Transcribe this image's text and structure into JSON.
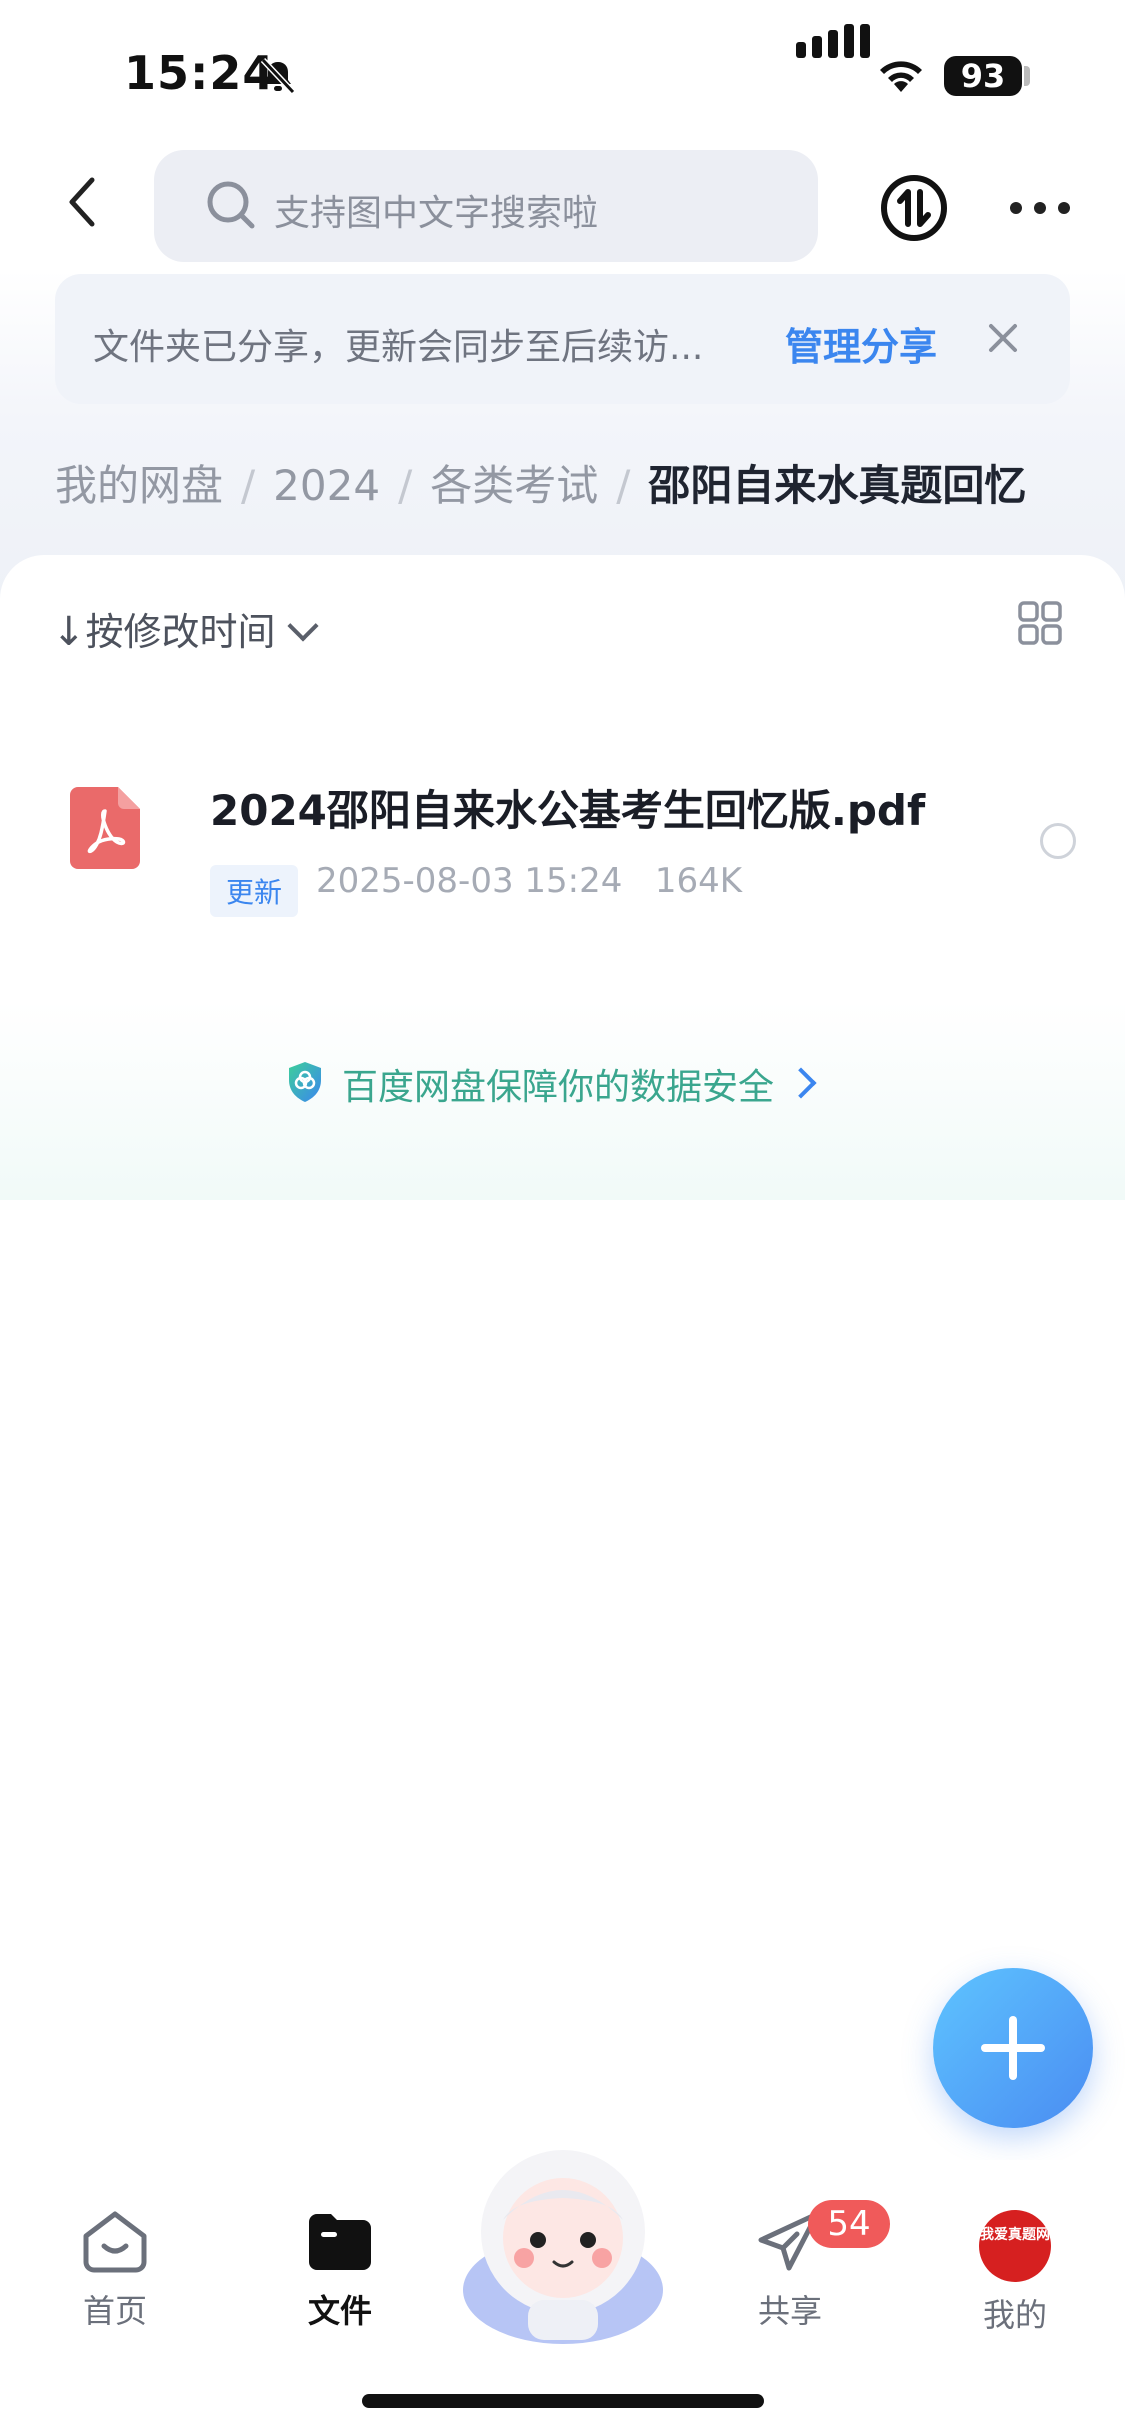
{
  "status_bar": {
    "time": "15:24",
    "battery": "93"
  },
  "search": {
    "placeholder": "支持图中文字搜索啦"
  },
  "notice": {
    "text": "文件夹已分享，更新会同步至后续访...",
    "link": "管理分享"
  },
  "breadcrumb": [
    "我的网盘",
    "2024",
    "各类考试",
    "邵阳自来水真题回忆"
  ],
  "sort": {
    "label": "按修改时间"
  },
  "files": [
    {
      "name": "2024邵阳自来水公基考生回忆版.pdf",
      "badge": "更新",
      "date": "2025-08-03 15:24",
      "size": "164K"
    }
  ],
  "security_banner": {
    "text": "百度网盘保障你的数据安全"
  },
  "tabs": {
    "home": "首页",
    "files": "文件",
    "share": "共享",
    "mine": "我的",
    "share_badge": "54"
  },
  "avatar_text": "我爱真题网",
  "colors": {
    "accent": "#3b86ef",
    "badge": "#f05a5a",
    "pdf": "#ea6a6a",
    "secure": "#3aa68e"
  }
}
